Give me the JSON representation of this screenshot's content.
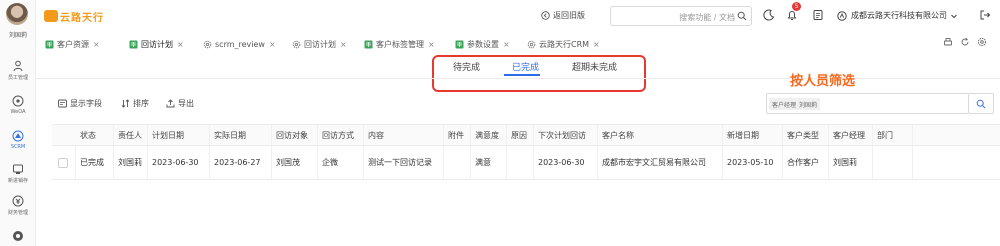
{
  "sidebar": {
    "user_name": "刘国莉",
    "items": [
      {
        "label": "员工管理",
        "icon": "person-icon"
      },
      {
        "label": "WeOA",
        "icon": "weoa-icon"
      },
      {
        "label": "SCRM",
        "icon": "scrm-icon"
      },
      {
        "label": "新进销存",
        "icon": "inventory-icon"
      },
      {
        "label": "财务管理",
        "icon": "finance-icon"
      },
      {
        "label": "",
        "icon": "more-icon"
      }
    ]
  },
  "header": {
    "logo_text": "云路天行",
    "back_old": "返回旧版",
    "search_placeholder": "搜索功能 / 文档",
    "notification_count": "5",
    "company": "成都云路天行科技有限公司"
  },
  "tabs": [
    {
      "label": "客户资源",
      "icon": "sheet-icon",
      "active": false
    },
    {
      "label": "回访计划",
      "icon": "sheet-icon",
      "active": true
    },
    {
      "label": "scrm_review",
      "icon": "gear-icon",
      "active": false
    },
    {
      "label": "回访计划",
      "icon": "gear-icon",
      "active": false
    },
    {
      "label": "客户标签管理",
      "icon": "sheet-icon",
      "active": false
    },
    {
      "label": "参数设置",
      "icon": "sheet-icon",
      "active": false
    },
    {
      "label": "云路天行CRM",
      "icon": "gear-icon",
      "active": false
    }
  ],
  "status_tabs": [
    "待完成",
    "已完成",
    "超期未完成"
  ],
  "active_status": "已完成",
  "annotation": "按人员筛选",
  "toolbar": {
    "show_fields": "显示字段",
    "sort": "排序",
    "export": "导出"
  },
  "filter": {
    "tag_key": "客户经理",
    "tag_value": "刘国莉"
  },
  "table": {
    "headers": [
      "状态",
      "责任人",
      "计划日期",
      "实际日期",
      "回访对象",
      "回访方式",
      "内容",
      "附件",
      "满意度",
      "原因",
      "下次计划回访",
      "客户名称",
      "新增日期",
      "客户类型",
      "客户经理",
      "部门"
    ],
    "rows": [
      [
        "已完成",
        "刘国莉",
        "2023-06-30",
        "2023-06-27",
        "刘国茂",
        "企微",
        "测试一下回访记录",
        "",
        "满意",
        "",
        "2023-06-30",
        "成都市宏宇文汇贸易有限公司",
        "2023-05-10",
        "合作客户",
        "刘国莉",
        ""
      ]
    ]
  }
}
